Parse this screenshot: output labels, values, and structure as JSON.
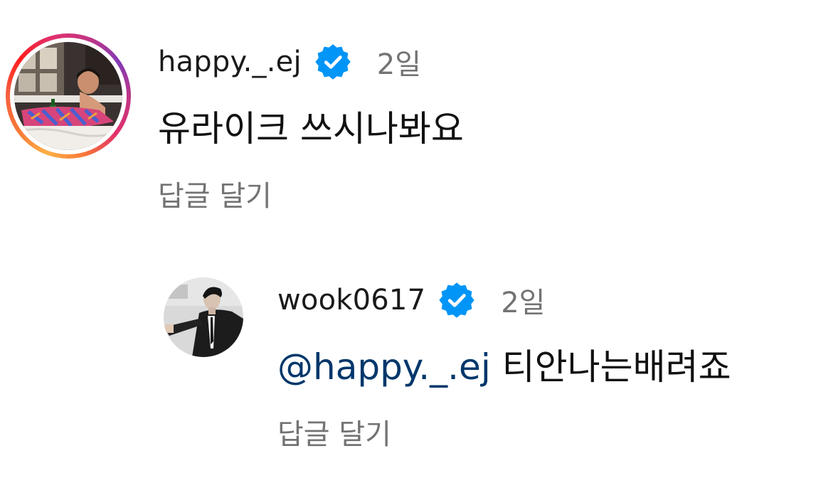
{
  "comments": [
    {
      "username": "happy._.ej",
      "time": "2일",
      "text": "유라이크 쓰시나봐요",
      "reply_label": "답글 달기"
    },
    {
      "username": "wook0617",
      "time": "2일",
      "mention": "@happy._.ej",
      "text": " 티안나는배려죠",
      "reply_label": "답글 달기"
    }
  ],
  "colors": {
    "verified_badge": "#0095f6",
    "mention": "#00376b",
    "muted": "#737373"
  },
  "icons": {
    "verified": "verified-badge-icon"
  }
}
